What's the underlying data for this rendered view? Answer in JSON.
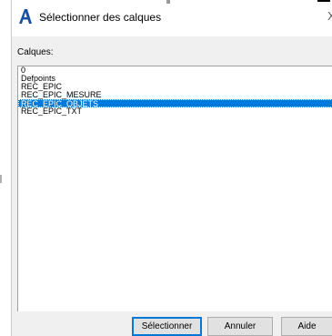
{
  "window": {
    "title": "Sélectionner des calques",
    "close_glyph": "X"
  },
  "colors": {
    "selection": "#0078d7",
    "dialog_bg": "#f0f0f0",
    "app_icon": "#1a4fa0"
  },
  "icons": {
    "app": "autocad-a-icon"
  },
  "main": {
    "label": "Calques:",
    "layers": [
      {
        "label": "0",
        "selected": false
      },
      {
        "label": "Defpoints",
        "selected": false
      },
      {
        "label": "REC_EPIC",
        "selected": false
      },
      {
        "label": "REC_EPIC_MESURE",
        "selected": false
      },
      {
        "label": "REC_EPIC_OBJETS",
        "selected": true
      },
      {
        "label": "REC_EPIC_TXT",
        "selected": false
      }
    ]
  },
  "buttons": {
    "select": "Sélectionner",
    "cancel": "Annuler",
    "help": "Aide"
  }
}
